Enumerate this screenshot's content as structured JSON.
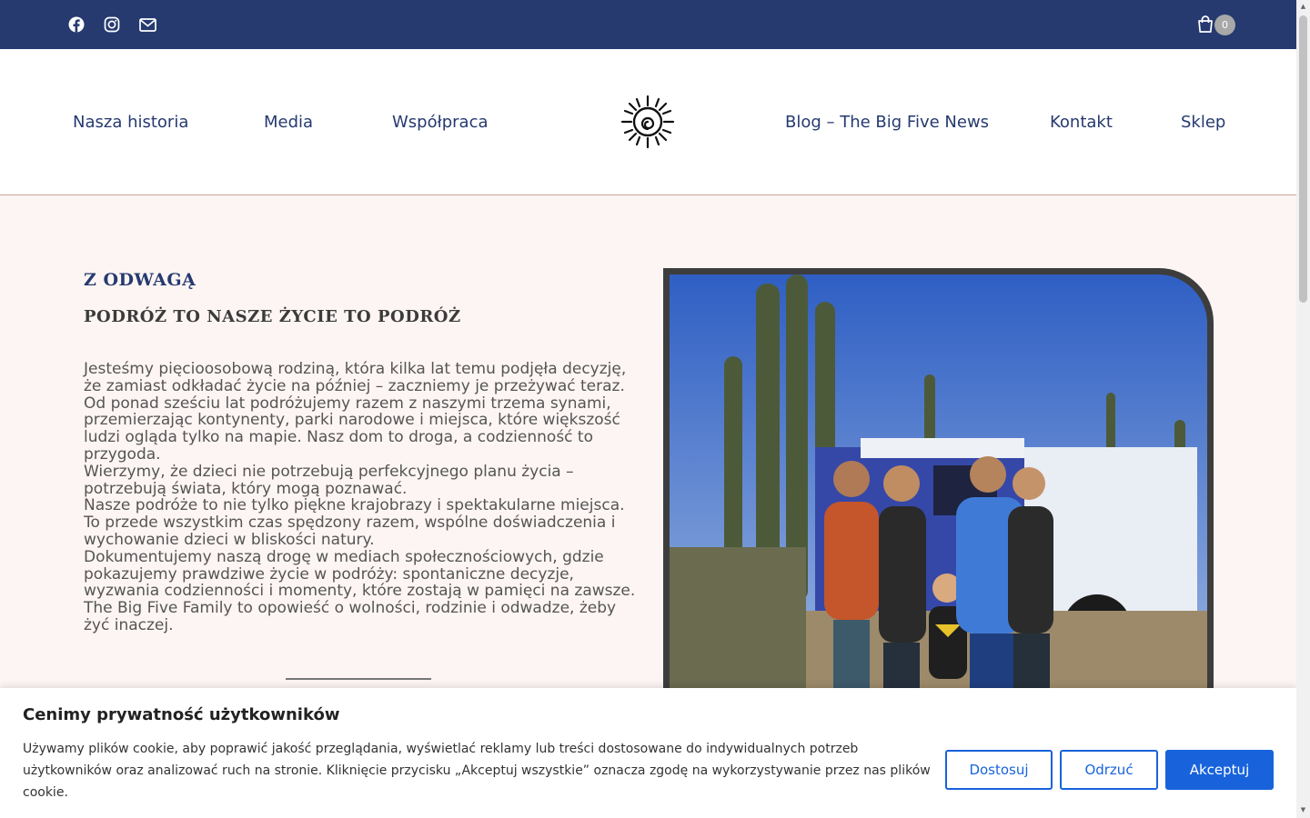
{
  "topbar": {
    "social_icons": [
      "facebook-icon",
      "instagram-icon",
      "mail-icon"
    ],
    "cart_count": "0"
  },
  "nav": {
    "left": [
      "Nasza historia",
      "Media",
      "Współpraca"
    ],
    "right": [
      "Blog – The Big Five News",
      "Kontakt",
      "Sklep"
    ]
  },
  "content": {
    "eyebrow": "Z ODWAGĄ",
    "heading": "PODRÓŻ TO NASZE ŻYCIE TO PODRÓŻ",
    "paragraphs": [
      "Jesteśmy pięcioosobową rodziną, która kilka lat temu podjęła decyzję, że zamiast odkładać życie na później – zaczniemy je przeżywać teraz.",
      "Od ponad sześciu lat podróżujemy razem z naszymi trzema synami, przemierzając kontynenty, parki narodowe i miejsca, które większość ludzi ogląda tylko na mapie. Nasz dom to droga, a codzienność to przygoda.",
      "Wierzymy, że dzieci nie potrzebują perfekcyjnego planu życia – potrzebują świata, który mogą poznawać.",
      "Nasze podróże to nie tylko piękne krajobrazy i spektakularne miejsca. To przede wszystkim czas spędzony razem, wspólne doświadczenia i wychowanie dzieci w bliskości natury.",
      "Dokumentujemy naszą drogę w mediach społecznościowych, gdzie pokazujemy prawdziwe życie w podróży: spontaniczne decyzje, wyzwania codzienności i momenty, które zostają w pamięci na zawsze.",
      "The Big Five Family to opowieść o wolności, rodzinie i odwadze, żeby żyć inaczej."
    ]
  },
  "cookie": {
    "title": "Cenimy prywatność użytkowników",
    "text": "Używamy plików cookie, aby poprawić jakość przeglądania, wyświetlać reklamy lub treści dostosowane do indywidualnych potrzeb użytkowników oraz analizować ruch na stronie. Kliknięcie przycisku „Akceptuj wszystkie” oznacza zgodę na wykorzystywanie przez nas plików cookie.",
    "customize_label": "Dostosuj",
    "reject_label": "Odrzuć",
    "accept_label": "Akceptuj"
  },
  "colors": {
    "topbar": "#263a70",
    "nav_text": "#263a70",
    "page_bg": "#fdf5f3",
    "accent_button": "#1863dc"
  }
}
